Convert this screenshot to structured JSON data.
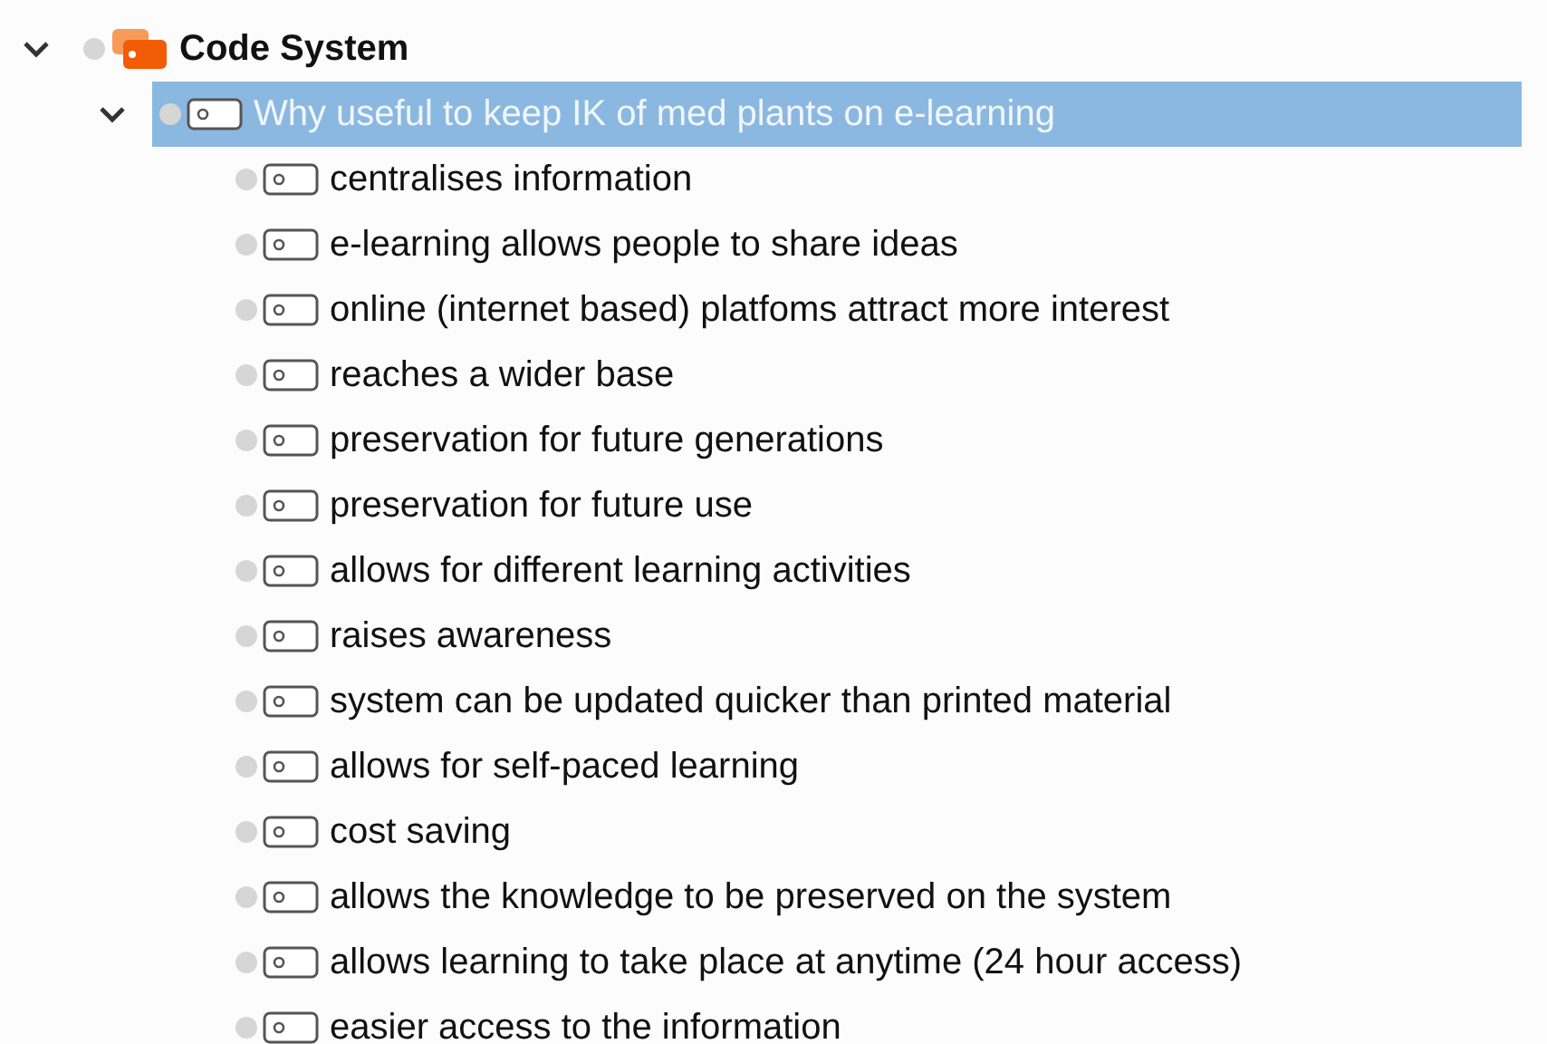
{
  "tree": [
    {
      "label": "Code System",
      "kind": "system",
      "expanded": true,
      "selected": false,
      "children": [
        {
          "label": "Why useful to keep IK of med plants on e-learning",
          "kind": "code",
          "expanded": true,
          "selected": true,
          "children": [
            {
              "label": "centralises information",
              "kind": "code",
              "selected": false
            },
            {
              "label": "e-learning allows people to share ideas",
              "kind": "code",
              "selected": false
            },
            {
              "label": "online (internet based) platfoms attract more interest",
              "kind": "code",
              "selected": false
            },
            {
              "label": "reaches a wider base",
              "kind": "code",
              "selected": false
            },
            {
              "label": "preservation for future generations",
              "kind": "code",
              "selected": false
            },
            {
              "label": "preservation for future use",
              "kind": "code",
              "selected": false
            },
            {
              "label": "allows for different learning activities",
              "kind": "code",
              "selected": false
            },
            {
              "label": "raises awareness",
              "kind": "code",
              "selected": false
            },
            {
              "label": "system can be updated quicker than printed material",
              "kind": "code",
              "selected": false
            },
            {
              "label": "allows for self-paced learning",
              "kind": "code",
              "selected": false
            },
            {
              "label": "cost saving",
              "kind": "code",
              "selected": false
            },
            {
              "label": "allows the knowledge to be preserved on the system",
              "kind": "code",
              "selected": false
            },
            {
              "label": "allows learning to take place at anytime (24 hour access)",
              "kind": "code",
              "selected": false
            },
            {
              "label": "easier access to the information",
              "kind": "code",
              "selected": false
            }
          ]
        }
      ]
    }
  ]
}
